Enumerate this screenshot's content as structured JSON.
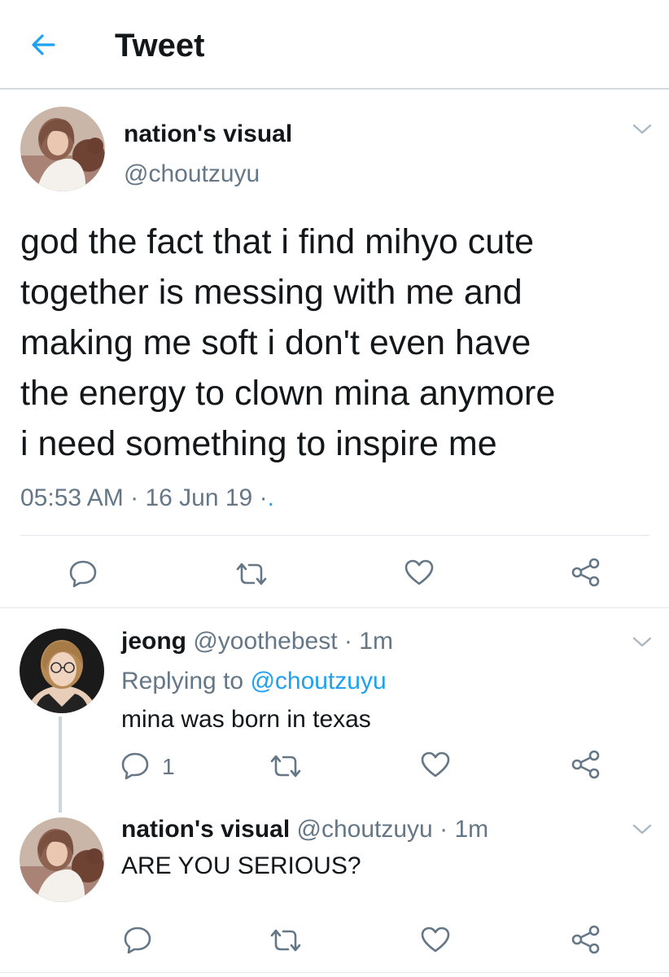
{
  "header": {
    "title": "Tweet"
  },
  "main_tweet": {
    "display_name": "nation's visual",
    "handle": "@choutzuyu",
    "text_lines": [
      "god the fact that i find mihyo cute",
      "together is messing with me and",
      "making me soft i don't even have",
      "the energy to clown mina anymore",
      "i need something to inspire me"
    ],
    "time": "05:53 AM",
    "sep1": "·",
    "date": "16 Jun 19",
    "sep2": "·",
    "trail": "."
  },
  "reply1": {
    "display_name": "jeong",
    "handle": "@yoothebest",
    "sep": "·",
    "age": "1m",
    "replying_prefix": "Replying to",
    "replying_handle": "@choutzuyu",
    "text": "mina was born in texas",
    "reply_count": "1"
  },
  "reply2": {
    "display_name": "nation's visual",
    "handle": "@choutzuyu",
    "sep": "·",
    "age": "1m",
    "text": "ARE YOU SERIOUS?"
  },
  "colors": {
    "accent": "#1da1f2",
    "muted": "#657786",
    "border": "#e1e8ed",
    "text": "#14171a"
  }
}
